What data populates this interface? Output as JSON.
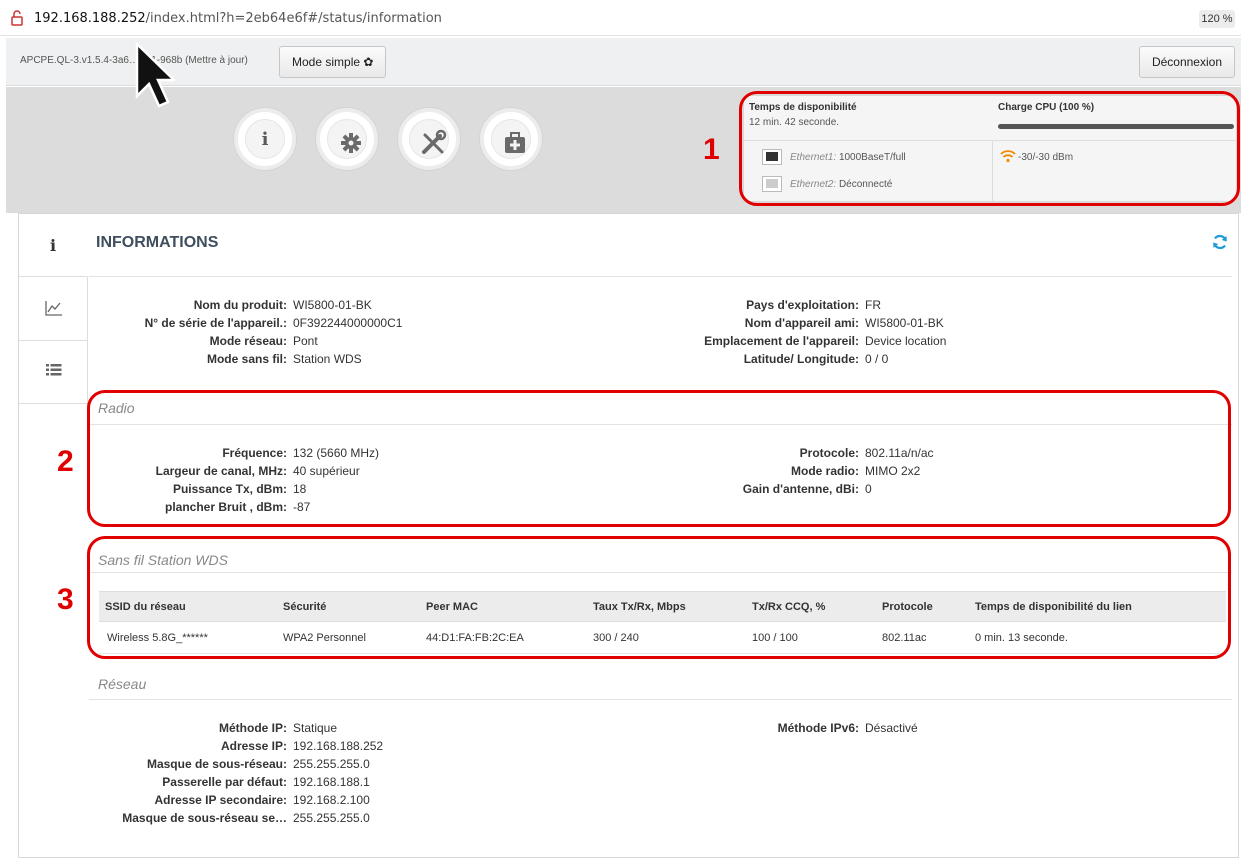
{
  "browser": {
    "url_host": "192.168.188.252",
    "url_path": "/index.html?h=2eb64e6f#/status/information",
    "zoom": "120 %"
  },
  "topbar": {
    "version": "APCPE.QL-3.v1.5.4-3a6…0V1-968b (Mettre à jour)",
    "mode_label": "Mode simple",
    "logout_label": "Déconnexion"
  },
  "nav_circles": [
    "info-icon",
    "gear-icon",
    "tools-icon",
    "toolbox-icon"
  ],
  "status": {
    "uptime_label": "Temps de disponibilité",
    "uptime_value": "12 min. 42 seconde.",
    "cpu_label": "Charge CPU (100 %)",
    "cpu_fraction": 1.0,
    "eth1_name": "Ethernet1:",
    "eth1_value": "1000BaseT/full",
    "eth2_name": "Ethernet2:",
    "eth2_value": "Déconnecté",
    "signal_value": "-30/-30 dBm"
  },
  "annotations": {
    "n1": "1",
    "n2": "2",
    "n3": "3"
  },
  "card": {
    "title": "INFORMATIONS"
  },
  "info": {
    "left": [
      {
        "k": "Nom du produit:",
        "v": "WI5800-01-BK"
      },
      {
        "k": "N° de série de l'appareil.:",
        "v": "0F392244000000C1"
      },
      {
        "k": "Mode réseau:",
        "v": "Pont"
      },
      {
        "k": "Mode sans fil:",
        "v": "Station  WDS"
      }
    ],
    "right": [
      {
        "k": "Pays d'exploitation:",
        "v": "FR"
      },
      {
        "k": "Nom d'appareil ami:",
        "v": "WI5800-01-BK"
      },
      {
        "k": "Emplacement de l'appareil:",
        "v": "Device location"
      },
      {
        "k": "Latitude/ Longitude:",
        "v": "0 / 0"
      }
    ]
  },
  "radio": {
    "title": "Radio",
    "left": [
      {
        "k": "Fréquence:",
        "v": "132 (5660 MHz)"
      },
      {
        "k": "Largeur de canal, MHz:",
        "v": "40 supérieur"
      },
      {
        "k": "Puissance Tx, dBm:",
        "v": "18"
      },
      {
        "k": "plancher Bruit , dBm:",
        "v": "-87"
      }
    ],
    "right": [
      {
        "k": "Protocole:",
        "v": "802.11a/n/ac"
      },
      {
        "k": "Mode radio:",
        "v": "MIMO 2x2"
      },
      {
        "k": "Gain d'antenne, dBi:",
        "v": "0"
      }
    ]
  },
  "wds": {
    "title": "Sans fil Station  WDS",
    "headers": [
      "SSID du réseau",
      "Sécurité",
      "Peer MAC",
      "Taux Tx/Rx, Mbps",
      "Tx/Rx CCQ, %",
      "Protocole",
      "Temps de disponibilité du lien"
    ],
    "row": [
      "Wireless 5.8G_******",
      "WPA2 Personnel",
      "44:D1:FA:FB:2C:EA",
      "300 / 240",
      "100 / 100",
      "802.11ac",
      "0 min. 13 seconde."
    ]
  },
  "network": {
    "title": "Réseau",
    "left": [
      {
        "k": "Méthode IP:",
        "v": "Statique"
      },
      {
        "k": "Adresse IP:",
        "v": "192.168.188.252"
      },
      {
        "k": "Masque de sous-réseau:",
        "v": "255.255.255.0"
      },
      {
        "k": "Passerelle par défaut:",
        "v": "192.168.188.1"
      },
      {
        "k": "Adresse IP secondaire:",
        "v": "192.168.2.100"
      },
      {
        "k": "Masque de sous-réseau se…",
        "v": "255.255.255.0"
      }
    ],
    "right": [
      {
        "k": "Méthode IPv6:",
        "v": "Désactivé"
      }
    ]
  }
}
